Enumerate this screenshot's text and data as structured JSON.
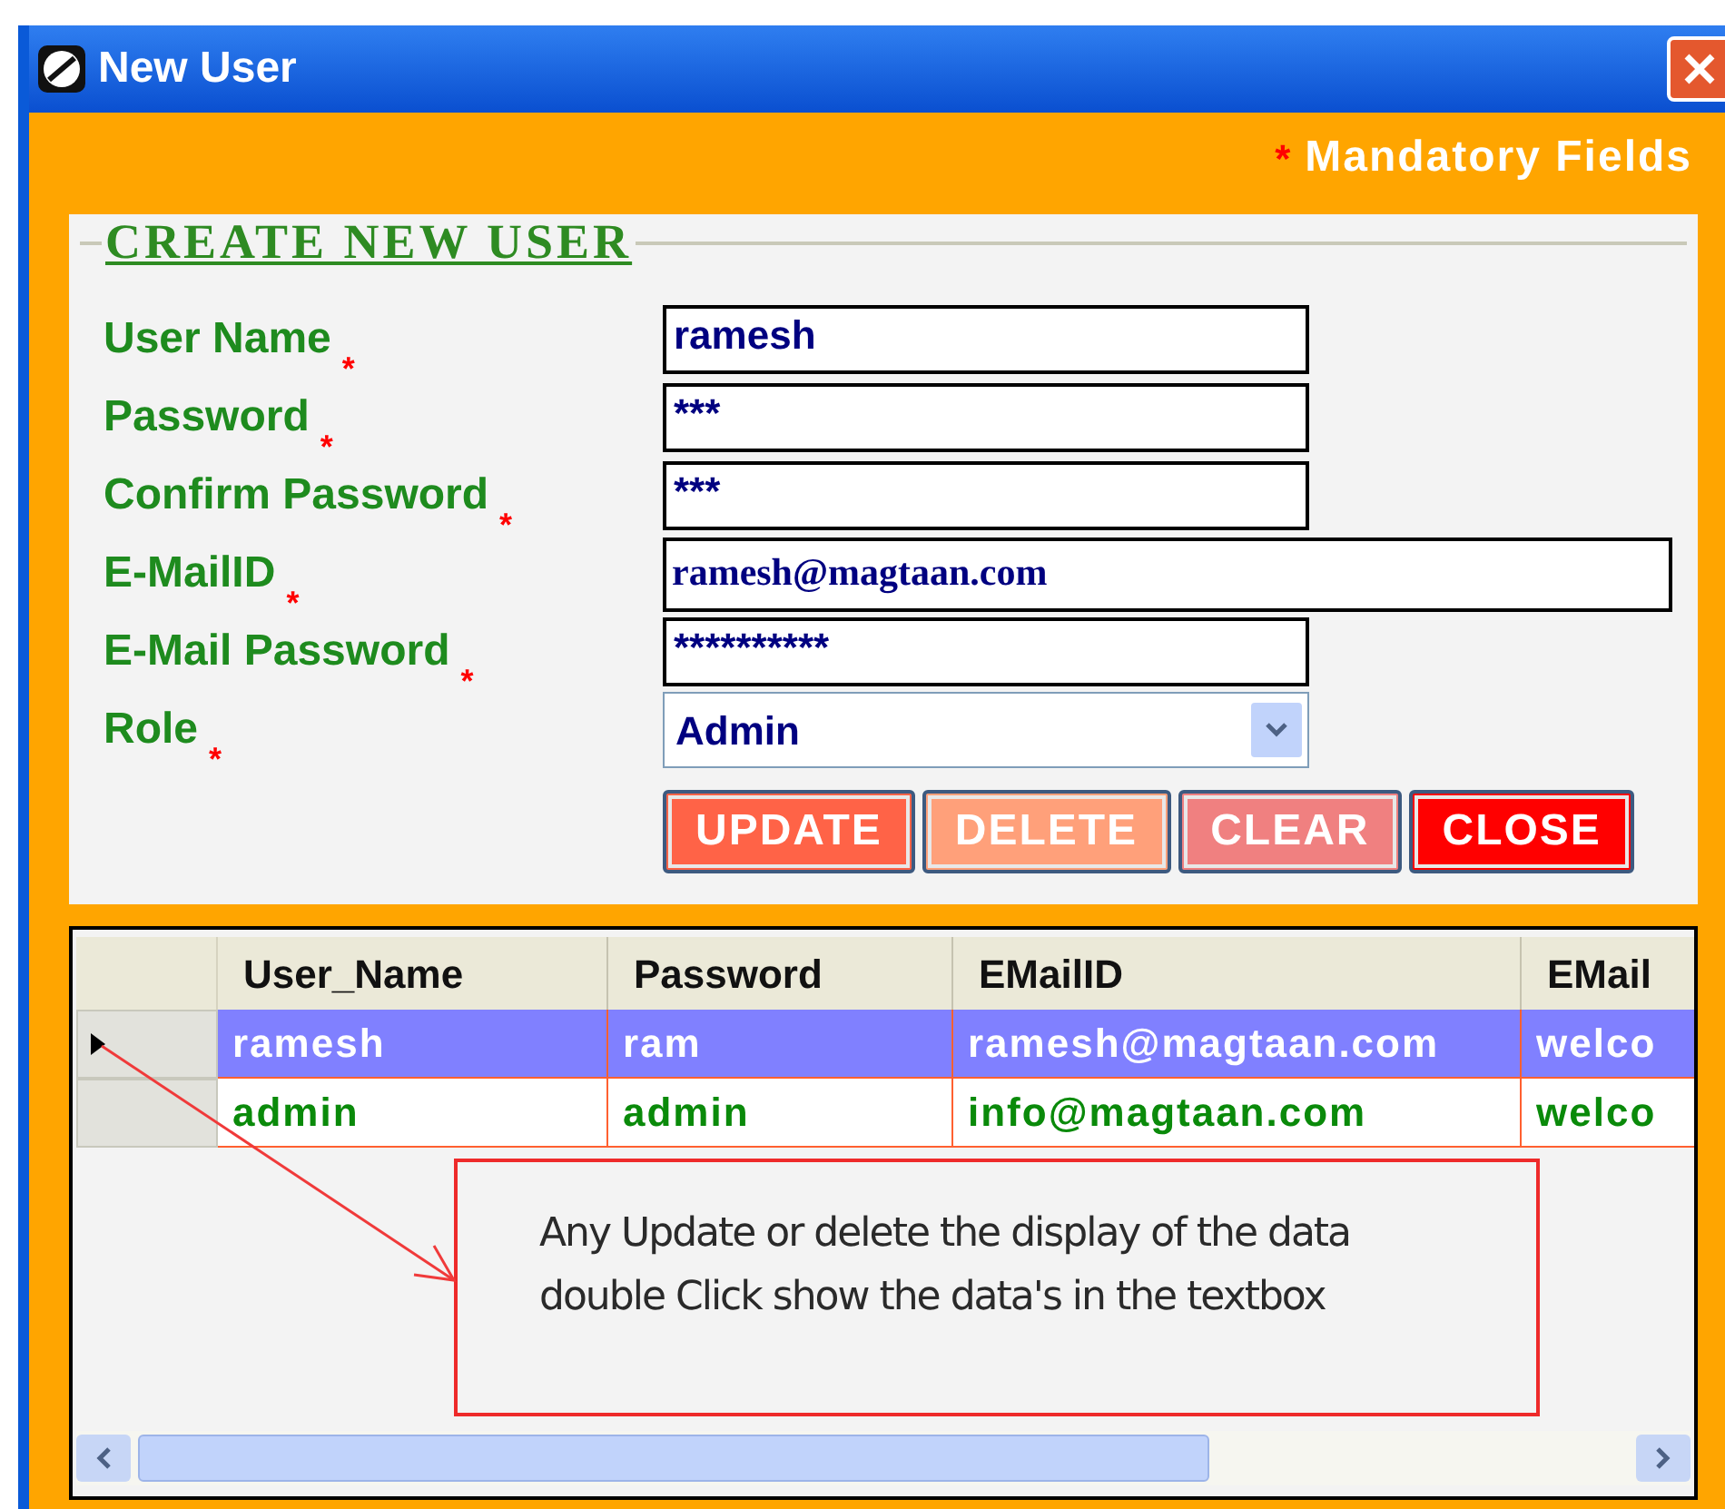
{
  "window": {
    "title": "New User"
  },
  "mandatory_note": {
    "marker": "*",
    "text": "Mandatory Fields"
  },
  "form": {
    "title": "CREATE NEW USER",
    "fields": [
      {
        "label": "User Name",
        "marker": "*",
        "kind": "text",
        "value": "ramesh"
      },
      {
        "label": "Password",
        "marker": "*",
        "kind": "text",
        "value": "***"
      },
      {
        "label": "Confirm Password",
        "marker": "*",
        "kind": "text",
        "value": "***"
      },
      {
        "label": "E-MailID",
        "marker": "*",
        "kind": "wide",
        "value": "ramesh@magtaan.com"
      },
      {
        "label": "E-Mail Password",
        "marker": "*",
        "kind": "text",
        "value": "**********"
      },
      {
        "label": "Role",
        "marker": "*",
        "kind": "select",
        "value": "Admin"
      }
    ],
    "buttons": [
      {
        "label": "UPDATE",
        "color": "#ff6347"
      },
      {
        "label": "DELETE",
        "color": "#ffa07a"
      },
      {
        "label": "CLEAR",
        "color": "#f08080"
      },
      {
        "label": "CLOSE",
        "color": "#ff0000"
      }
    ]
  },
  "table": {
    "columns": [
      "User_Name",
      "Password",
      "EMailID",
      "EMail"
    ],
    "rows": [
      {
        "selected": true,
        "cells": [
          "ramesh",
          "ram",
          "ramesh@magtaan.com",
          "welco"
        ]
      },
      {
        "selected": false,
        "cells": [
          "admin",
          "admin",
          "info@magtaan.com",
          "welco"
        ]
      }
    ]
  },
  "callout": {
    "text": "Any Update or delete  the display of the data double Click show the data's in the textbox"
  }
}
